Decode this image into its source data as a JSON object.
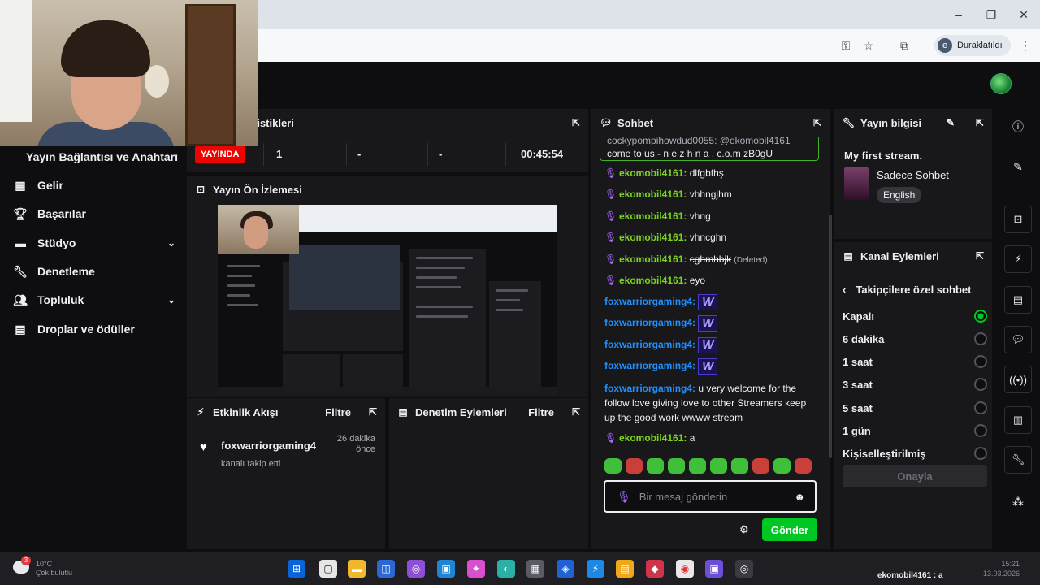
{
  "browser": {
    "profile_initial": "e",
    "profile_label": "Duraklatıldı",
    "window_controls": [
      "–",
      "❐",
      "✕"
    ]
  },
  "nav": {
    "title": "Yayın Bağlantısı ve Anahtarı",
    "items": [
      {
        "label": "Gelir",
        "icon": "revenue-icon"
      },
      {
        "label": "Başarılar",
        "icon": "trophy-icon"
      },
      {
        "label": "Stüdyo",
        "icon": "studio-icon",
        "expandable": true
      },
      {
        "label": "Denetleme",
        "icon": "wrench-icon"
      },
      {
        "label": "Topluluk",
        "icon": "community-icon",
        "expandable": true
      },
      {
        "label": "Droplar ve ödüller",
        "icon": "drops-icon"
      }
    ]
  },
  "stats": {
    "title": "tistikleri",
    "live_label": "YAYINDA",
    "viewers": "1",
    "stat2": "-",
    "stat3": "-",
    "uptime": "00:45:54"
  },
  "preview": {
    "title": "Yayın Ön İzlemesi"
  },
  "activity": {
    "title": "Etkinlik Akışı",
    "filter": "Filtre",
    "event": {
      "user": "foxwarriorgaming4",
      "action": "kanalı takip etti",
      "time_line1": "26 dakika",
      "time_line2": "önce"
    }
  },
  "modactions": {
    "title": "Denetim Eylemleri",
    "filter": "Filtre"
  },
  "chat": {
    "title": "Sohbet",
    "pinned_line1": "cockypompihowdud0055: @ekomobil4161",
    "pinned_line2": "come to us - n e z h n a . c.o.m zB0gU",
    "messages": [
      {
        "user": "ekomobil4161",
        "text": "dlfgbfhş"
      },
      {
        "user": "ekomobil4161",
        "text": "vhhngjhm"
      },
      {
        "user": "ekomobil4161",
        "text": "vhng"
      },
      {
        "user": "ekomobil4161",
        "text": "vhncghn"
      },
      {
        "user": "ekomobil4161",
        "text": "cghmhbjk",
        "note": "(Deleted)"
      },
      {
        "user": "ekomobil4161",
        "text": "eyo"
      }
    ],
    "fox_user": "foxwarriorgaming4",
    "emote_glyph": "W",
    "long_msg": "u very welcome for the follow love giving love to other Streamers keep up the good work wwww stream",
    "last_user": "ekomobil4161",
    "last_text": "a",
    "placeholder": "Bir mesaj gönderin",
    "send_label": "Gönder"
  },
  "stream_info": {
    "title": "Yayın bilgisi",
    "stream_title": "My first stream.",
    "category": "Sadece Sohbet",
    "language": "English"
  },
  "channel_actions": {
    "title": "Kanal Eylemleri",
    "sub_title": "Takipçilere özel sohbet",
    "options": [
      {
        "label": "Kapalı",
        "selected": true
      },
      {
        "label": "6 dakika",
        "selected": false
      },
      {
        "label": "1 saat",
        "selected": false
      },
      {
        "label": "3 saat",
        "selected": false
      },
      {
        "label": "5 saat",
        "selected": false
      },
      {
        "label": "1 gün",
        "selected": false
      },
      {
        "label": "Kişiselleştirilmiş",
        "selected": false
      }
    ],
    "confirm_label": "Onayla"
  },
  "taskbar": {
    "weather_badge": "3",
    "weather_temp": "10°C",
    "weather_desc": "Çok bulutlu",
    "tray_text": "ekomobil4161 : a",
    "time": "15:21",
    "date": "13.03.2026"
  },
  "colors": {
    "live": "#eb0400",
    "accent_green": "#00c722",
    "mic_purple": "#a970ff"
  }
}
